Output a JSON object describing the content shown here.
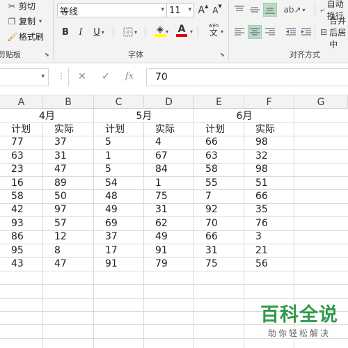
{
  "ribbon": {
    "clipboard": {
      "cut": "剪切",
      "copy": "复制",
      "format_painter": "格式刷",
      "group_label": "剪贴板"
    },
    "font": {
      "name": "等线",
      "size": "11",
      "group_label": "字体",
      "grow": "A",
      "shrink": "A",
      "bold": "B",
      "italic": "I",
      "underline": "U",
      "font_color_glyph": "A",
      "phonetic": "wén"
    },
    "alignment": {
      "group_label": "对齐方式",
      "wrap_text": "自动换行",
      "merge": "合并后居中"
    }
  },
  "formula_bar": {
    "value": "70",
    "cancel": "✕",
    "enter": "✓",
    "fx": "fx"
  },
  "sheet": {
    "columns": [
      "A",
      "B",
      "C",
      "D",
      "E",
      "F",
      "G"
    ],
    "months": [
      "4月",
      "5月",
      "6月"
    ],
    "subheaders": [
      "计划",
      "实际",
      "计划",
      "实际",
      "计划",
      "实际"
    ],
    "rows": [
      [
        "77",
        "37",
        "5",
        "4",
        "66",
        "98"
      ],
      [
        "63",
        "31",
        "1",
        "67",
        "63",
        "32"
      ],
      [
        "23",
        "47",
        "5",
        "84",
        "58",
        "98"
      ],
      [
        "16",
        "89",
        "54",
        "1",
        "55",
        "51"
      ],
      [
        "58",
        "50",
        "48",
        "75",
        "7",
        "66"
      ],
      [
        "42",
        "97",
        "49",
        "31",
        "92",
        "35"
      ],
      [
        "93",
        "57",
        "69",
        "62",
        "70",
        "76"
      ],
      [
        "86",
        "12",
        "37",
        "49",
        "66",
        "3"
      ],
      [
        "95",
        "8",
        "17",
        "91",
        "31",
        "21"
      ],
      [
        "43",
        "47",
        "91",
        "79",
        "75",
        "56"
      ]
    ]
  },
  "watermark": {
    "title": "百科全说",
    "subtitle": "助你轻松解决"
  }
}
